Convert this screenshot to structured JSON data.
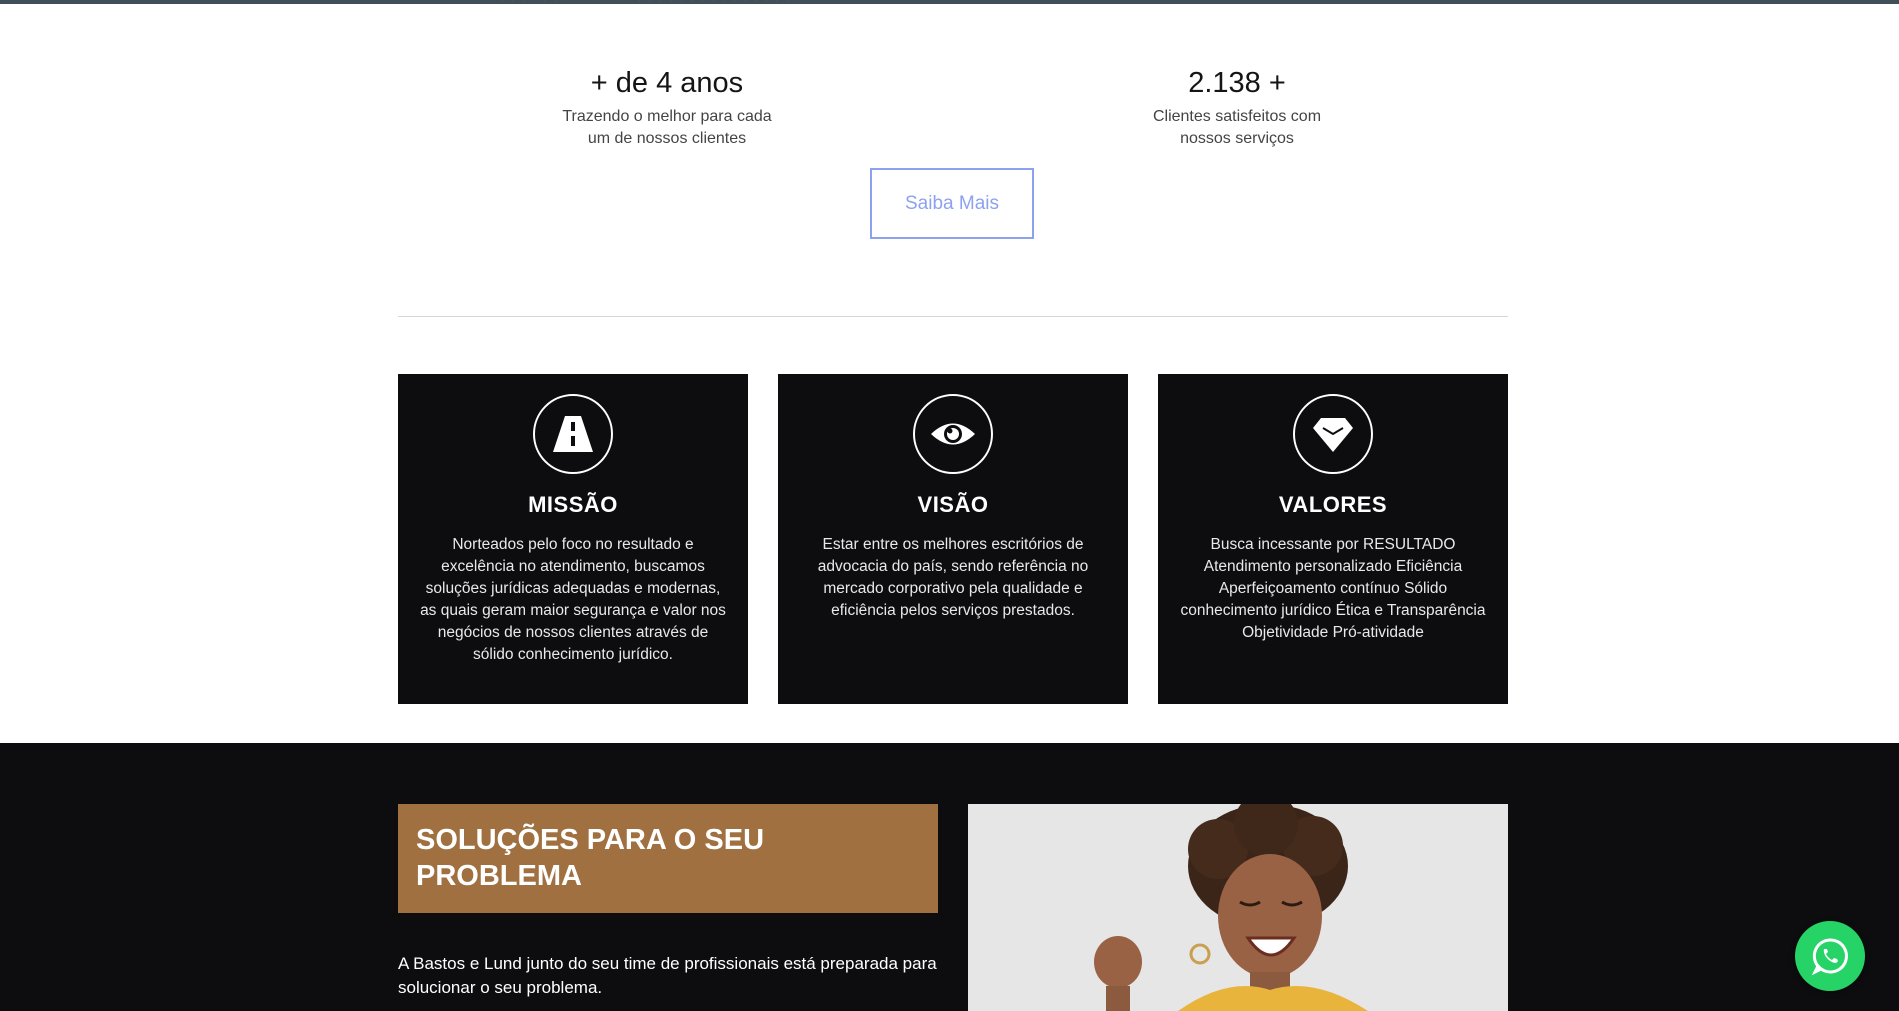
{
  "stats": [
    {
      "value": "+ de 4 anos",
      "caption_line1": "Trazendo o melhor para cada",
      "caption_line2": "um de nossos clientes"
    },
    {
      "value": "2.138 +",
      "caption_line1": "Clientes satisfeitos com",
      "caption_line2": "nossos serviços"
    }
  ],
  "saiba_mais_label": "Saiba Mais",
  "cards": [
    {
      "icon": "road-icon",
      "title": "MISSÃO",
      "text": "Norteados pelo foco no resultado e excelência no atendimento, buscamos soluções jurídicas adequadas e modernas, as quais geram maior segurança e valor nos negócios de nossos clientes através de sólido conhecimento jurídico."
    },
    {
      "icon": "eye-icon",
      "title": "VISÃO",
      "text": "Estar entre os melhores escritórios de advocacia do país, sendo referência no mercado corporativo pela qualidade e eficiência pelos serviços prestados."
    },
    {
      "icon": "diamond-icon",
      "title": "VALORES",
      "text": "Busca incessante por RESULTADO Atendimento personalizado Eficiência Aperfeiçoamento contínuo Sólido conhecimento jurídico Ética e Transparência Objetividade Pró-atividade"
    }
  ],
  "solutions": {
    "heading": "SOLUÇÕES PARA O SEU PROBLEMA",
    "text": "A Bastos e Lund junto do seu time de profissionais está preparada para solucionar o seu problema."
  },
  "colors": {
    "accent_brown": "#a07040",
    "button_blue": "#8ca2ef",
    "whatsapp_green": "#25d366",
    "dark_bg": "#0d0c0f"
  },
  "whatsapp_icon": "whatsapp-icon"
}
